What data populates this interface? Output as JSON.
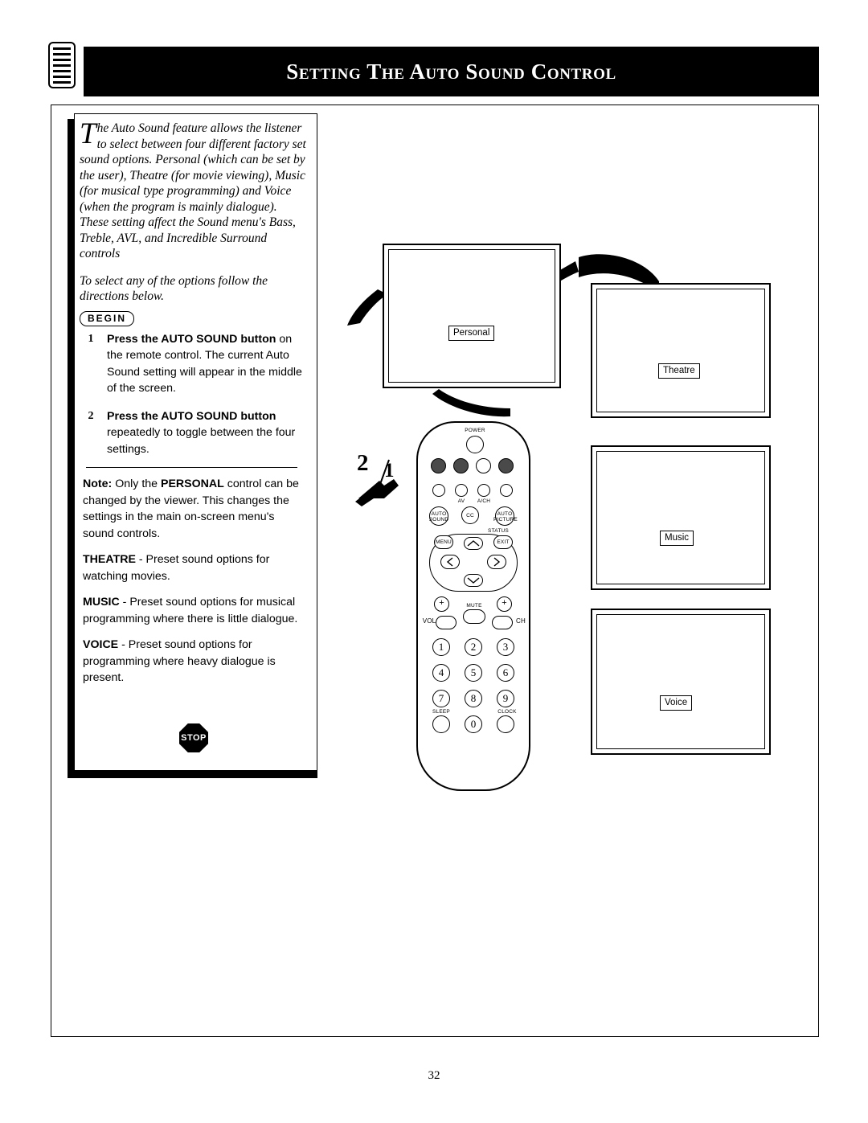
{
  "header": {
    "title": "Setting the Auto Sound Control",
    "icon": "remote-control-icon"
  },
  "intro": {
    "dropcap": "T",
    "paragraph": "he Auto Sound feature allows the listener to select between four different factory set sound options. Personal (which can be set by the user), Theatre (for movie viewing), Music (for musical type programming) and Voice (when the program is mainly dialogue). These setting affect the Sound menu's Bass, Treble, AVL, and Incredible Surround controls",
    "directions": "To select any of the options follow the directions below."
  },
  "begin_label": "BEGIN",
  "steps": [
    {
      "number": "1",
      "bold": "Press the AUTO  SOUND button",
      "rest": " on the remote control. The current Auto Sound setting will appear in the middle of the screen."
    },
    {
      "number": "2",
      "bold": "Press the AUTO  SOUND button",
      "rest": " repeatedly to toggle between the four settings.",
      "rest_bold": "repeatedly"
    }
  ],
  "notes": [
    {
      "lead": "Note:",
      "strong": "PERSONAL",
      "text_before": " Only the ",
      "text_after": " control can be changed by the viewer. This changes the settings in the main on-screen menu's sound controls."
    },
    {
      "strong": "THEATRE",
      "text_after": " - Preset sound options for watching movies."
    },
    {
      "strong": "MUSIC",
      "text_after": " - Preset sound options for musical programming where there is little dialogue."
    },
    {
      "strong": "VOICE",
      "text_after": " - Preset sound options for programming where heavy dialogue is present."
    }
  ],
  "stop_label": "STOP",
  "tv_screens": [
    {
      "id": "personal",
      "label": "Personal"
    },
    {
      "id": "theatre",
      "label": "Theatre"
    },
    {
      "id": "music",
      "label": "Music"
    },
    {
      "id": "voice",
      "label": "Voice"
    }
  ],
  "remote": {
    "power_label": "POWER",
    "row2": [
      "AV",
      "A/CH"
    ],
    "row3": [
      "AUTO SOUND",
      "CC",
      "AUTO PICTURE"
    ],
    "status_label": "STATUS",
    "menu_label": "MENU",
    "exit_label": "EXIT",
    "mute_label": "MUTE",
    "vol_label": "VOL",
    "ch_label": "CH",
    "plus_left": "+",
    "plus_right": "+",
    "keypad": [
      "1",
      "2",
      "3",
      "4",
      "5",
      "6",
      "7",
      "8",
      "9",
      "0"
    ],
    "sleep_label": "SLEEP",
    "clock_label": "CLOCK"
  },
  "callout": {
    "step_two": "2",
    "step_one": "1"
  },
  "page_number": "32"
}
